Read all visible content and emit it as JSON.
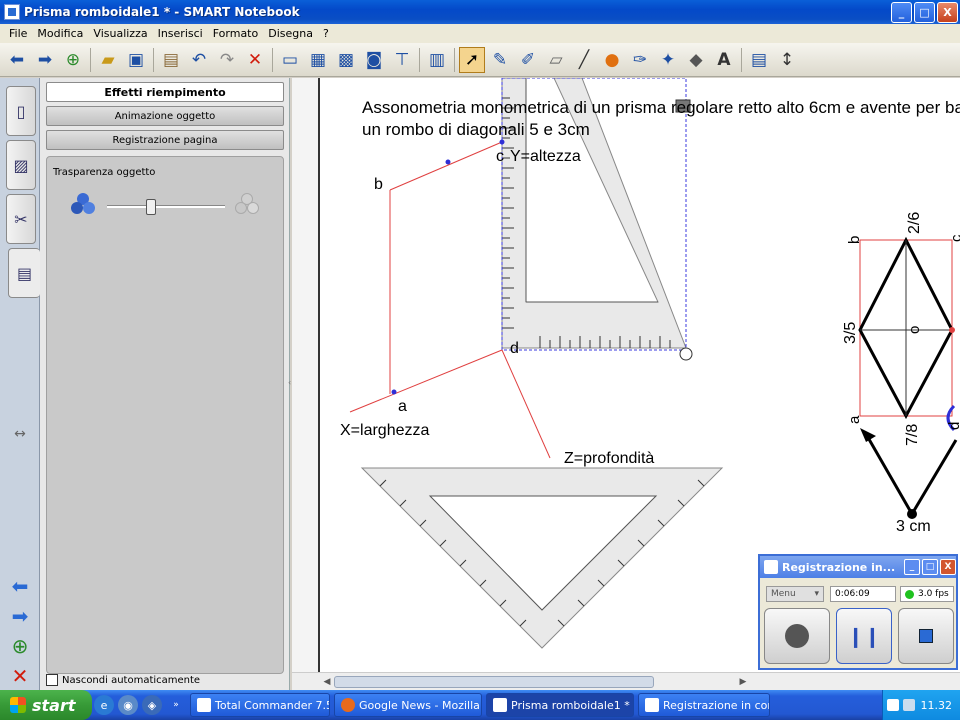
{
  "window": {
    "title": "Prisma romboidale1 * - SMART Notebook",
    "minimize": "_",
    "maximize": "□",
    "close": "X"
  },
  "menu": [
    "File",
    "Modifica",
    "Visualizza",
    "Inserisci",
    "Formato",
    "Disegna",
    "?"
  ],
  "toolbar": {
    "icons": [
      "back-icon",
      "forward-icon",
      "add-page-icon",
      "open-icon",
      "save-icon",
      "paste-icon",
      "undo-icon",
      "redo-icon",
      "delete-icon",
      "screen-shade-icon",
      "display-icon",
      "projector-icon",
      "capture-icon",
      "table-icon",
      "select-icon",
      "pen-icon",
      "creative-pen-icon",
      "eraser-icon",
      "line-icon",
      "shape-icon",
      "magic-pen-icon",
      "fill-icon",
      "text-icon",
      "properties-icon",
      "move-toolbar-icon"
    ],
    "selected": "select-icon"
  },
  "properties": {
    "tabs": [
      "Effetti riempimento",
      "Animazione oggetto",
      "Registrazione pagina"
    ],
    "active_tab": "Effetti riempimento",
    "transparency_label": "Trasparenza oggetto",
    "autohide_label": "Nascondi automaticamente"
  },
  "canvas": {
    "heading_line1": "Assonometria monometrica di un prisma regolare retto alto 6cm e avente per base",
    "heading_line2": "un rombo di diagonali 5 e 3cm",
    "labels": {
      "c": "c",
      "y_axis": "Y=altezza",
      "b": "b",
      "d": "d",
      "a": "a",
      "x_axis": "X=larghezza",
      "z_axis": "Z=profondità"
    },
    "rhombus_labels": {
      "top": "2/6",
      "left": "3/5",
      "center": "o",
      "bottom": "7/8",
      "b": "b",
      "c": "c",
      "a": "a",
      "d": "d",
      "measure": "3 cm"
    }
  },
  "recorder": {
    "title": "Registrazione in...",
    "menu_label": "Menu",
    "elapsed": "0:06:09",
    "fps": "3.0 fps"
  },
  "taskbar": {
    "start_label": "start",
    "tasks": [
      "Total Commander 7.5...",
      "Google News - Mozilla...",
      "Prisma romboidale1 * ...",
      "Registrazione in cors..."
    ],
    "active_task": "Prisma romboidale1 * ...",
    "clock": "11.32"
  },
  "colors": {
    "titlebar": "#0a5fd8",
    "taskbar": "#245edb",
    "start": "#379a37",
    "guide_red": "#e04040",
    "selection_blue": "#3a3adf"
  }
}
